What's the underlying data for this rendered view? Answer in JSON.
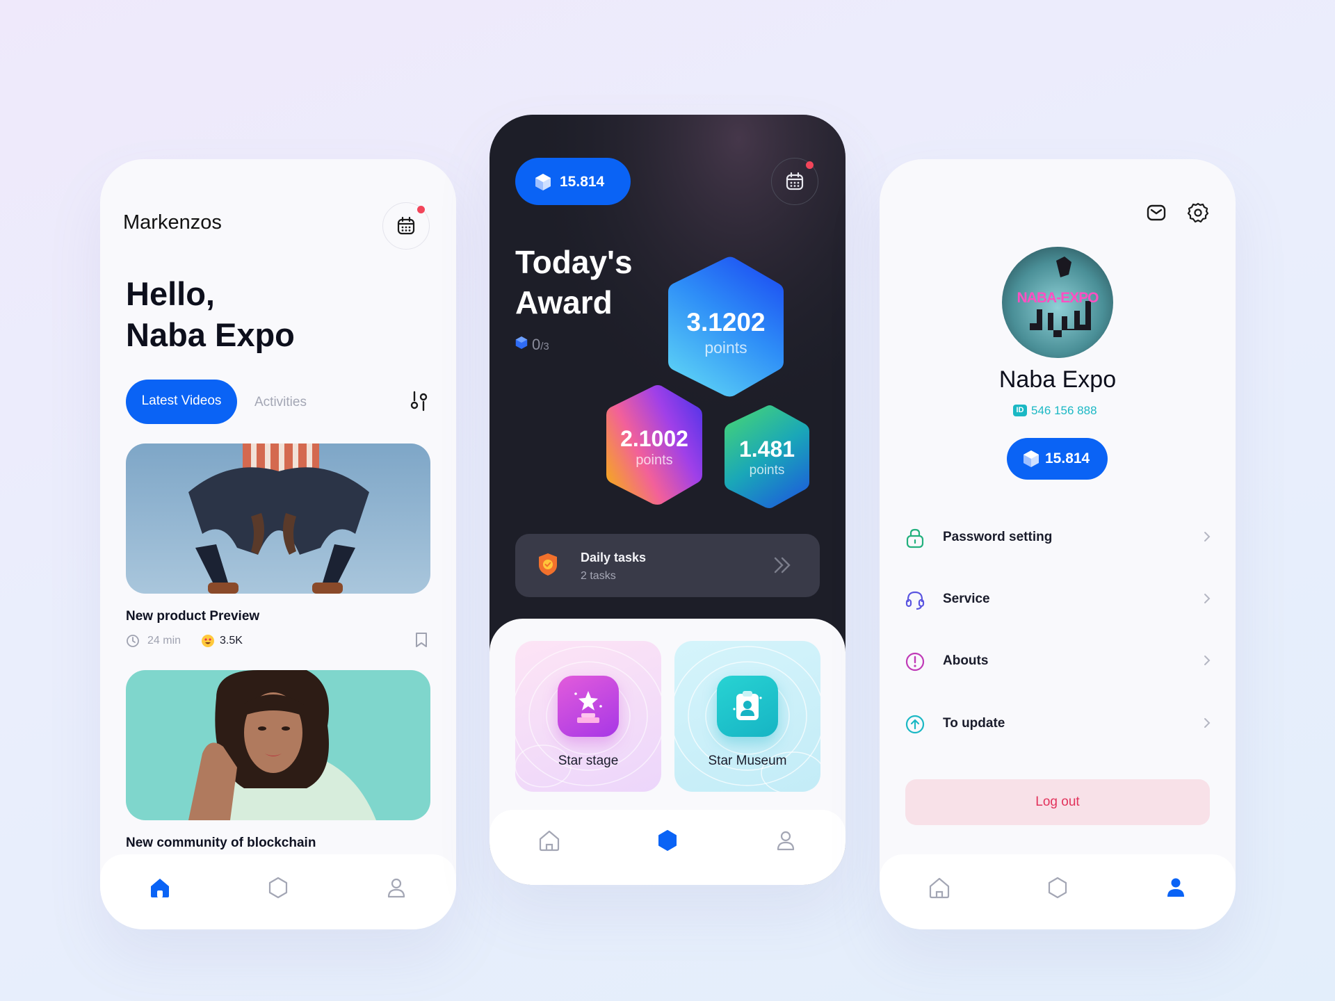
{
  "colors": {
    "accent": "#0a63f5",
    "notify": "#f2455a",
    "logout_bg": "#f8e1e8",
    "logout_text": "#e2325b",
    "teal": "#1bb8c4"
  },
  "phone_home": {
    "brand": "Markenzos",
    "greeting_line1": "Hello,",
    "greeting_line2": "Naba Expo",
    "tabs": [
      {
        "label": "Latest Videos",
        "active": true
      },
      {
        "label": "Activities",
        "active": false
      }
    ],
    "videos": [
      {
        "title": "New product Preview",
        "duration": "24 min",
        "reactions": "3.5K"
      },
      {
        "title": "New community of blockchain"
      }
    ],
    "nav": [
      {
        "icon": "home-icon",
        "active": true
      },
      {
        "icon": "hexagon-icon",
        "active": false
      },
      {
        "icon": "user-icon",
        "active": false
      }
    ]
  },
  "phone_award": {
    "balance": "15.814",
    "title_line1": "Today's",
    "title_line2": "Award",
    "progress_value": "0",
    "progress_total": "/3",
    "awards": [
      {
        "value": "3.1202",
        "unit": "points"
      },
      {
        "value": "2.1002",
        "unit": "points"
      },
      {
        "value": "1.481",
        "unit": "points"
      }
    ],
    "daily": {
      "title": "Daily tasks",
      "subtitle": "2 tasks"
    },
    "features": [
      {
        "label": "Star stage"
      },
      {
        "label": "Star Museum"
      }
    ],
    "nav": [
      {
        "icon": "home-icon",
        "active": false
      },
      {
        "icon": "hexagon-icon",
        "active": true
      },
      {
        "icon": "user-icon",
        "active": false
      }
    ]
  },
  "phone_profile": {
    "avatar_text": "NABA-EXPO",
    "name": "Naba Expo",
    "id_badge": "ID",
    "id_number": "546 156 888",
    "balance": "15.814",
    "menu": [
      {
        "label": "Password setting",
        "icon": "lock-icon"
      },
      {
        "label": "Service",
        "icon": "headset-icon"
      },
      {
        "label": "Abouts",
        "icon": "info-icon"
      },
      {
        "label": "To update",
        "icon": "upload-icon"
      }
    ],
    "logout": "Log out",
    "nav": [
      {
        "icon": "home-icon",
        "active": false
      },
      {
        "icon": "hexagon-icon",
        "active": false
      },
      {
        "icon": "user-icon",
        "active": true
      }
    ]
  }
}
